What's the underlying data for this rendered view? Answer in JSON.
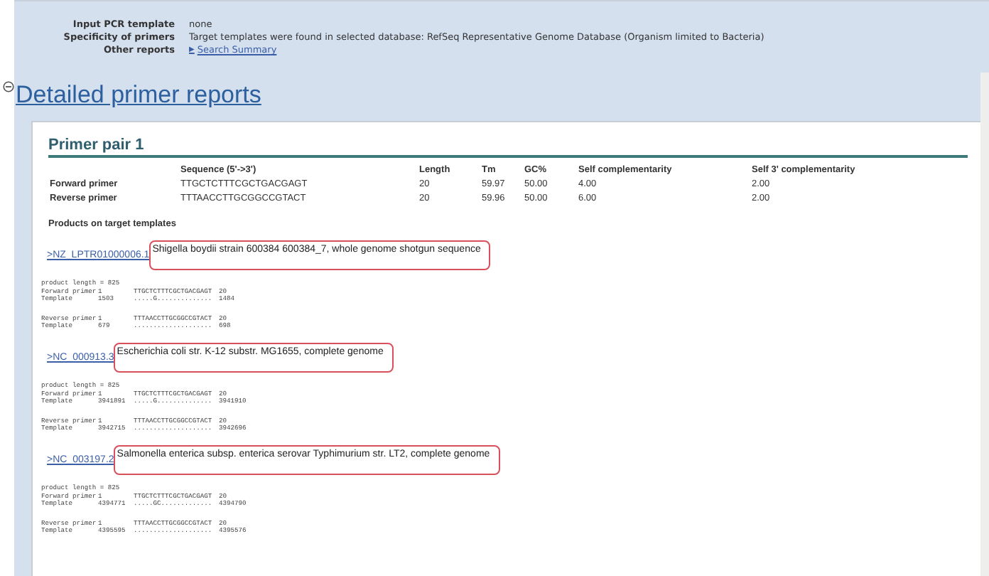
{
  "summary": [
    {
      "label": "Input PCR template",
      "value": "none",
      "kind": "text"
    },
    {
      "label": "Specificity of primers",
      "value": "Target templates were found in selected database: RefSeq Representative Genome Database (Organism limited to Bacteria)",
      "kind": "text"
    },
    {
      "label": "Other reports",
      "value": "Search Summary",
      "kind": "link",
      "icon": "▶"
    }
  ],
  "section_title": "Detailed primer reports",
  "primer_pair": {
    "title": "Primer pair 1",
    "columns": [
      "",
      "Sequence (5'->3')",
      "Length",
      "Tm",
      "GC%",
      "Self complementarity",
      "Self 3' complementarity"
    ],
    "rows": [
      [
        "Forward primer",
        "TTGCTCTTTCGCTGACGAGT",
        "20",
        "59.97",
        "50.00",
        "4.00",
        "2.00"
      ],
      [
        "Reverse primer",
        "TTTAACCTTGCGGCCGTACT",
        "20",
        "59.96",
        "50.00",
        "6.00",
        "2.00"
      ]
    ]
  },
  "products_title": "Products on target templates",
  "products": [
    {
      "accession": ">NZ_LPTR01000006.1",
      "description": "Shigella boydii strain 600384 600384_7, whole genome shotgun sequence",
      "product_length": "product length = 825",
      "blocks": [
        [
          [
            "Forward primer",
            "1",
            "TTGCTCTTTCGCTGACGAGT",
            "20"
          ],
          [
            "Template",
            "1503",
            ".....G..............",
            "1484"
          ]
        ],
        [
          [
            "Reverse primer",
            "1",
            "TTTAACCTTGCGGCCGTACT",
            "20"
          ],
          [
            "Template",
            "679",
            "....................",
            "698"
          ]
        ]
      ]
    },
    {
      "accession": ">NC_000913.3",
      "description": "Escherichia coli str. K-12 substr. MG1655, complete genome",
      "product_length": "product length = 825",
      "blocks": [
        [
          [
            "Forward primer",
            "1",
            "TTGCTCTTTCGCTGACGAGT",
            "20"
          ],
          [
            "Template",
            "3941891",
            ".....G..............",
            "3941910"
          ]
        ],
        [
          [
            "Reverse primer",
            "1",
            "TTTAACCTTGCGGCCGTACT",
            "20"
          ],
          [
            "Template",
            "3942715",
            "....................",
            "3942696"
          ]
        ]
      ]
    },
    {
      "accession": ">NC_003197.2",
      "description": "Salmonella enterica subsp. enterica serovar Typhimurium str. LT2, complete genome",
      "product_length": "product length = 825",
      "blocks": [
        [
          [
            "Forward primer",
            "1",
            "TTGCTCTTTCGCTGACGAGT",
            "20"
          ],
          [
            "Template",
            "4394771",
            ".....GC.............",
            "4394790"
          ]
        ],
        [
          [
            "Reverse primer",
            "1",
            "TTTAACCTTGCGGCCGTACT",
            "20"
          ],
          [
            "Template",
            "4395595",
            "....................",
            "4395576"
          ]
        ]
      ]
    }
  ]
}
